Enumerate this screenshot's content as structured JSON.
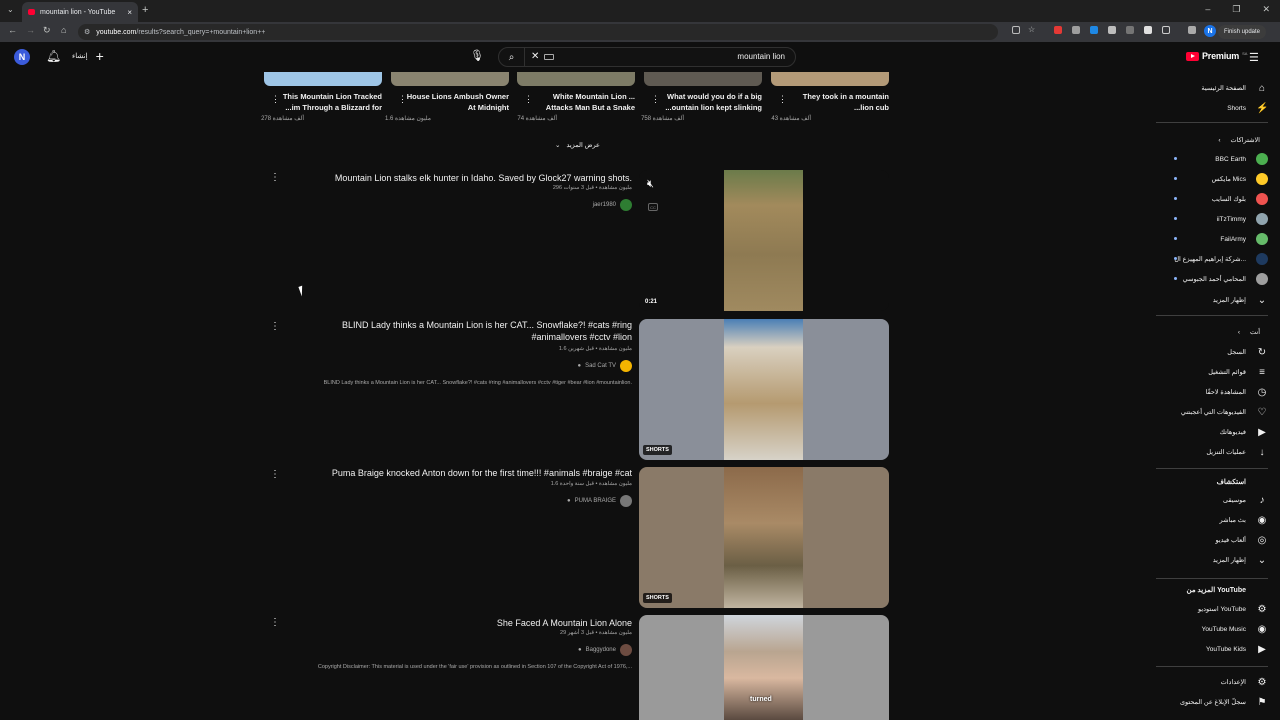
{
  "browser": {
    "tab_title": "mountain lion - YouTube",
    "url_host": "youtube.com",
    "url_path": "/results?search_query=+mountain+lion++",
    "finish_update": "Finish update",
    "profile_initial": "N",
    "new_tab": "+",
    "close_tab": "×"
  },
  "masthead": {
    "avatar_initial": "N",
    "create_label": "إنشاء",
    "search_query": "mountain lion",
    "logo_text": "Premium",
    "logo_region": "SA"
  },
  "shelf": {
    "items": [
      {
        "title": "This Mountain Lion Tracked ...im Through a Blizzard for",
        "views": "278 ألف مشاهدة",
        "color": "#9ec5e6"
      },
      {
        "title": "House Lions Ambush Owner At Midnight",
        "views": "1.6 مليون مشاهدة",
        "color": "#8a8470"
      },
      {
        "title": "White Mountain Lion ... Attacks Man But a Snake",
        "views": "74 ألف مشاهدة",
        "color": "#7d7b66"
      },
      {
        "title": "What would you do if a big ...ountain lion kept slinking",
        "views": "758 ألف مشاهدة",
        "color": "#5f5a52"
      },
      {
        "title": "They took in a mountain ...lion cub",
        "views": "43 ألف مشاهدة",
        "color": "#b39a78"
      }
    ],
    "show_more": "عرض المزيد"
  },
  "results": [
    {
      "title": "Mountain Lion stalks elk hunter in Idaho. Saved by Glock27 warning shots.",
      "meta": "296 مليون مشاهدة • قبل 3 سنوات",
      "channel": "jaer1980",
      "channel_color": "#2e7d32",
      "description": "",
      "badge": "",
      "duration": "0:21",
      "thumb_bg": "#0f0f0f",
      "inner_color": "#9a8555"
    },
    {
      "title": "BLIND Lady thinks a Mountain Lion is her CAT... Snowflake?! #cats #ring #animallovers #cctv #lion",
      "meta": "1.6 مليون مشاهدة • قبل شهرين",
      "channel": "Sad Cat TV",
      "channel_color": "#f4b400",
      "description": "BLIND Lady thinks a Mountain Lion is her CAT... Snowflake?! #cats #ring #animallovers #cctv #tiger #bear #lion #mountainlion.",
      "badge": "SHORTS",
      "duration": "",
      "thumb_bg": "#8a8f99",
      "inner_color": "#b9a68a"
    },
    {
      "title": "Puma Braige knocked Anton down for the first time!!! #animals #braige #cat",
      "meta": "1.6 مليون مشاهدة • قبل سنة واحدة",
      "channel": "PUMA BRAIGE",
      "channel_color": "#777777",
      "description": "",
      "badge": "SHORTS",
      "duration": "",
      "thumb_bg": "#8a7a68",
      "inner_color": "#9c8568"
    },
    {
      "title": "She Faced A Mountain Lion Alone",
      "meta": "29 مليون مشاهدة • قبل 3 أشهر",
      "channel": "Baggydone",
      "channel_color": "#6d4c41",
      "description": "Copyright Disclaimer: This material is used under the 'fair use' provision as outlined in Section 107 of the Copyright Act of 1976,...",
      "badge": "",
      "duration": "",
      "thumb_bg": "#9a9a9a",
      "inner_color": "#c9b9a6",
      "caption": "turned"
    }
  ],
  "sidebar": {
    "top": [
      {
        "label": "الصفحة الرئيسية",
        "icon": "home-icon",
        "glyph": "⌂"
      },
      {
        "label": "Shorts",
        "icon": "shorts-icon",
        "glyph": "⚡"
      }
    ],
    "subs_head": "الاشتراكات",
    "subs": [
      {
        "label": "BBC Earth",
        "color": "#4caf50"
      },
      {
        "label": "مايكس Mics",
        "color": "#ffca28"
      },
      {
        "label": "بلوك السايب",
        "color": "#ef5350"
      },
      {
        "label": "iiTzTimmy",
        "color": "#90a4ae"
      },
      {
        "label": "FailArmy",
        "color": "#66bb6a"
      },
      {
        "label": "شركة إبراهيم المهيزع ال...",
        "color": "#1e3a5f"
      },
      {
        "label": "المحامي أحمد الجبوسي",
        "color": "#9e9e9e"
      }
    ],
    "subs_more": "إظهار المزيد",
    "you_head": "أنت",
    "you": [
      {
        "label": "السجل",
        "icon": "history-icon",
        "glyph": "↻"
      },
      {
        "label": "قوائم التشغيل",
        "icon": "playlists-icon",
        "glyph": "≡"
      },
      {
        "label": "المشاهدة لاحقًا",
        "icon": "watch-later-icon",
        "glyph": "◷"
      },
      {
        "label": "الفيديوهات التي أعجبتني",
        "icon": "like-icon",
        "glyph": "♡"
      },
      {
        "label": "فيديوهاتك",
        "icon": "your-videos-icon",
        "glyph": "▶"
      },
      {
        "label": "عمليات التنزيل",
        "icon": "download-icon",
        "glyph": "↓"
      }
    ],
    "explore_head": "استكشاف",
    "explore": [
      {
        "label": "موسيقى",
        "icon": "music-icon",
        "glyph": "♪"
      },
      {
        "label": "بث مباشر",
        "icon": "live-icon",
        "glyph": "◉"
      },
      {
        "label": "ألعاب فيديو",
        "icon": "gaming-icon",
        "glyph": "◎"
      },
      {
        "label": "إظهار المزيد",
        "icon": "chevron-down-icon",
        "glyph": "⌄"
      }
    ],
    "more_head": "المزيد من YouTube",
    "more": [
      {
        "label": "استوديو YouTube",
        "icon": "studio-icon",
        "glyph": "⚙"
      },
      {
        "label": "YouTube Music",
        "icon": "yt-music-icon",
        "glyph": "◉"
      },
      {
        "label": "YouTube Kids",
        "icon": "yt-kids-icon",
        "glyph": "▶"
      }
    ],
    "bottom": [
      {
        "label": "الإعدادات",
        "icon": "settings-icon",
        "glyph": "⚙"
      },
      {
        "label": "سجلّ الإبلاغ عن المحتوى",
        "icon": "flag-icon",
        "glyph": "⚑"
      }
    ]
  }
}
